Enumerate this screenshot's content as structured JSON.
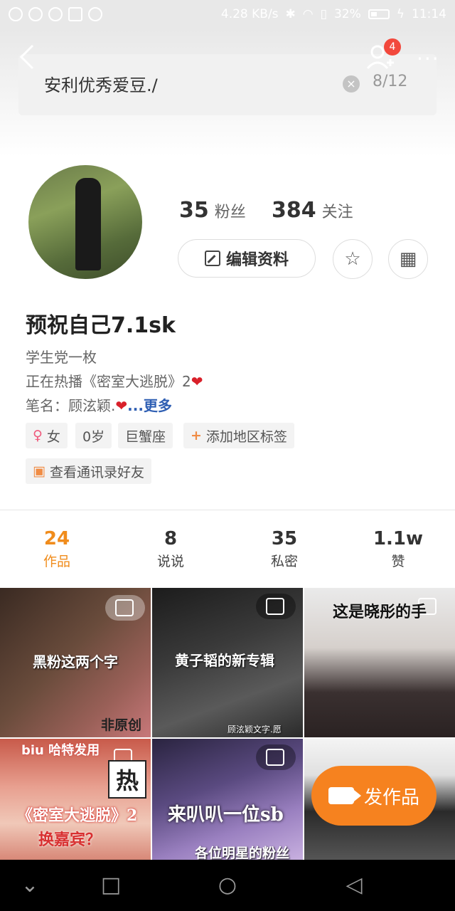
{
  "status_bar": {
    "speed": "4.28 KB/s",
    "battery": "32%",
    "time": "11:14"
  },
  "header": {
    "notification_count": "4",
    "more_symbol": "···"
  },
  "edit_field": {
    "value": "安利优秀爱豆./",
    "counter": "8/12"
  },
  "profile": {
    "followers_count": "35",
    "followers_label": "粉丝",
    "following_count": "384",
    "following_label": "关注",
    "edit_button": "编辑资料",
    "nickname": "预祝自己7.1sk",
    "bio_line1": "学生党一枚",
    "bio_line2": "正在热播《密室大逃脱》2",
    "bio_line3": "笔名：顾泫颖.",
    "more_link": "...更多",
    "tags": [
      "女",
      "0岁",
      "巨蟹座",
      "添加地区标签"
    ],
    "contacts_tag": "查看通讯录好友"
  },
  "tabs": [
    {
      "count": "24",
      "label": "作品"
    },
    {
      "count": "8",
      "label": "说说"
    },
    {
      "count": "35",
      "label": "私密"
    },
    {
      "count": "1.1w",
      "label": "赞"
    }
  ],
  "grid": [
    {
      "caption": "黑粉这两个字",
      "corner": "非原创"
    },
    {
      "caption": "黄子韬的新专辑",
      "corner": "顾泫颖文字.愿"
    },
    {
      "caption": "这是晓彤的手",
      "corner": ""
    },
    {
      "caption": "《密室大逃脱》2",
      "sub": "换嘉宾？",
      "top": "biu 哈特发用",
      "hot": "热"
    },
    {
      "caption": "来叭叭一位sb",
      "corner": "各位明星的粉丝"
    },
    {
      "caption": "",
      "corner": ""
    }
  ],
  "fab": {
    "label": "发作品"
  },
  "colors": {
    "accent": "#f08c1c",
    "fab": "#f6821f",
    "badge": "#f2483c",
    "link": "#2f5fb3"
  }
}
